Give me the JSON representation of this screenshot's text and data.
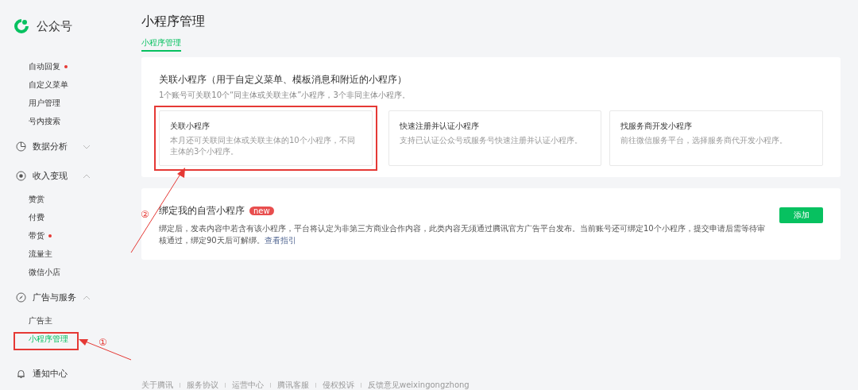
{
  "brand": {
    "name": "公众号"
  },
  "sidebar": {
    "items": [
      {
        "kind": "sub",
        "label": "自动回复",
        "dot": true,
        "selected": false
      },
      {
        "kind": "sub",
        "label": "自定义菜单",
        "dot": false,
        "selected": false
      },
      {
        "kind": "sub",
        "label": "用户管理",
        "dot": false,
        "selected": false
      },
      {
        "kind": "sub",
        "label": "号内搜索",
        "dot": false,
        "selected": false
      },
      {
        "kind": "group",
        "label": "数据分析",
        "expanded": false
      },
      {
        "kind": "group",
        "label": "收入变现",
        "expanded": true
      },
      {
        "kind": "sub",
        "label": "赞赏",
        "dot": false,
        "selected": false
      },
      {
        "kind": "sub",
        "label": "付费",
        "dot": false,
        "selected": false
      },
      {
        "kind": "sub",
        "label": "带货",
        "dot": true,
        "selected": false
      },
      {
        "kind": "sub",
        "label": "流量主",
        "dot": false,
        "selected": false
      },
      {
        "kind": "sub",
        "label": "微信小店",
        "dot": false,
        "selected": false
      },
      {
        "kind": "group",
        "label": "广告与服务",
        "expanded": true
      },
      {
        "kind": "sub",
        "label": "广告主",
        "dot": false,
        "selected": false
      },
      {
        "kind": "sub",
        "label": "小程序管理",
        "dot": false,
        "selected": true
      },
      {
        "kind": "group",
        "label": "通知中心"
      }
    ]
  },
  "page": {
    "title": "小程序管理",
    "tabs": [
      {
        "label": "小程序管理",
        "selected": true
      }
    ]
  },
  "link_section": {
    "title": "关联小程序（用于自定义菜单、模板消息和附近的小程序）",
    "subtitle": "1个账号可关联10个“同主体或关联主体”小程序，3个非同主体小程序。",
    "cards": [
      {
        "title": "关联小程序",
        "description": "本月还可关联同主体或关联主体的10个小程序，不同主体的3个小程序。",
        "highlighted": true
      },
      {
        "title": "快速注册并认证小程序",
        "description": "支持已认证公众号或服务号快速注册并认证小程序。",
        "highlighted": false
      },
      {
        "title": "找服务商开发小程序",
        "description": "前往微信服务平台，选择服务商代开发小程序。",
        "highlighted": false
      }
    ]
  },
  "bind_section": {
    "title": "绑定我的自营小程序",
    "badge": "new",
    "description": "绑定后，发表内容中若含有该小程序，平台将认定为非第三方商业合作内容，此类内容无须通过腾讯官方广告平台发布。当前账号还可绑定10个小程序，提交申请后需等待审核通过，绑定90天后可解绑。",
    "link": "查看指引",
    "button": "添加"
  },
  "annotations": [
    {
      "label": "①"
    },
    {
      "label": "②"
    }
  ],
  "footer": {
    "links": [
      "关于腾讯",
      "服务协议",
      "运营中心",
      "腾讯客服",
      "侵权投诉",
      "反馈意见weixingongzhong"
    ]
  }
}
